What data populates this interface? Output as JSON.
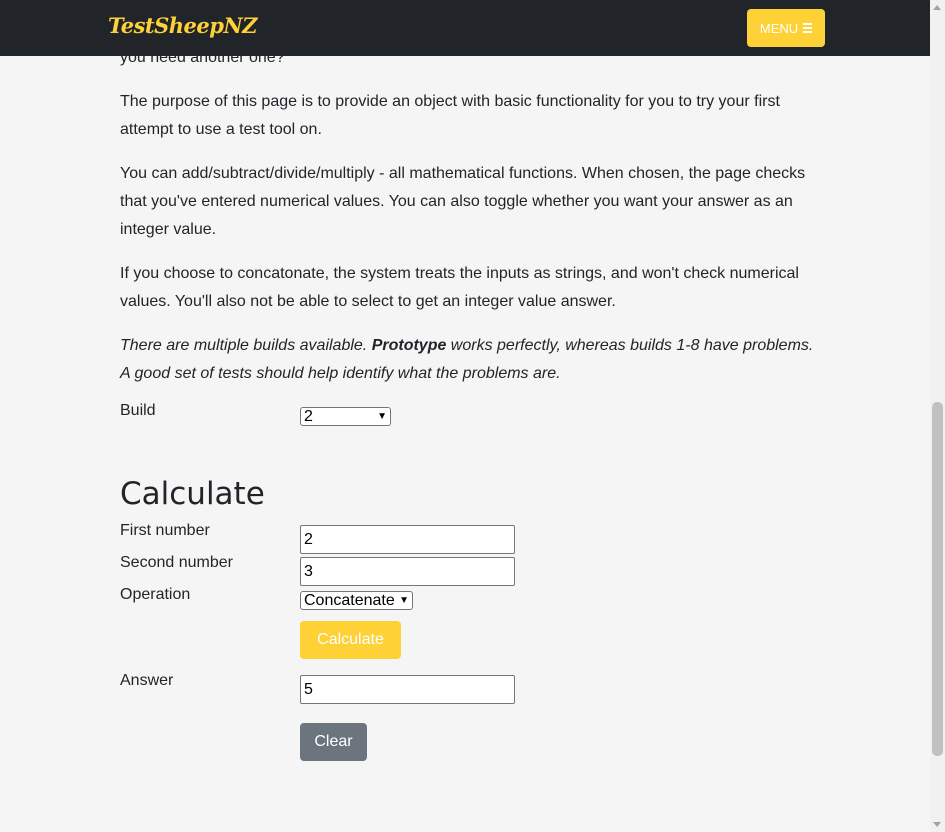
{
  "nav": {
    "brand": "TestSheepNZ",
    "menu_label": "MENU",
    "menu_icon": "hamburger-icon"
  },
  "intro": {
    "partial_line": "you need another one?",
    "p1": "The purpose of this page is to provide an object with basic functionality for you to try your first attempt to use a test tool on.",
    "p2": "You can add/subtract/divide/multiply - all mathematical functions. When chosen, the page checks that you've entered numerical values. You can also toggle whether you want your answer as an integer value.",
    "p3": "If you choose to concatonate, the system treats the inputs as strings, and won't check numerical values. You'll also not be able to select to get an integer value answer.",
    "p4_start": "There are multiple builds available. ",
    "p4_bold": "Prototype",
    "p4_end": " works perfectly, whereas builds 1-8 have problems. A good set of tests should help identify what the problems are."
  },
  "build": {
    "label": "Build",
    "value": "2"
  },
  "calculate": {
    "title": "Calculate",
    "first_label": "First number",
    "first_value": "2",
    "second_label": "Second number",
    "second_value": "3",
    "operation_label": "Operation",
    "operation_value": "Concatenate",
    "calculate_button": "Calculate",
    "answer_label": "Answer",
    "answer_value": "5",
    "clear_button": "Clear"
  },
  "colors": {
    "accent": "#fed136",
    "navbar": "#212529",
    "secondary": "#6c757d",
    "background": "#f5f5f5"
  }
}
